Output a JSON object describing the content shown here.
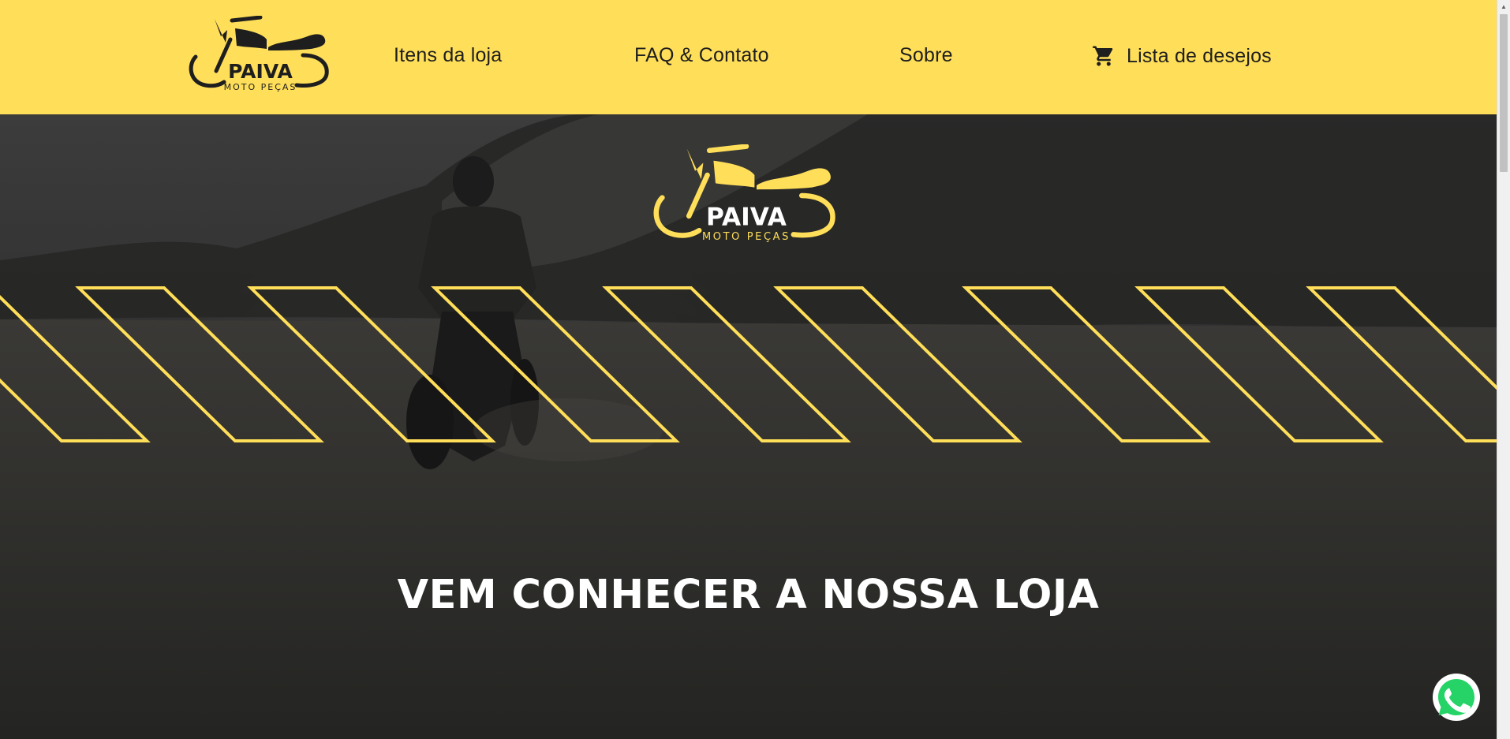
{
  "brand": {
    "name": "PAIVA",
    "subtitle": "MOTO PEÇAS"
  },
  "nav": {
    "items": [
      {
        "label": "Itens da loja"
      },
      {
        "label": "FAQ & Contato"
      },
      {
        "label": "Sobre"
      },
      {
        "label": "Lista de desejos",
        "icon": "cart-icon"
      }
    ]
  },
  "hero": {
    "title": "VEM CONHECER A NOSSA LOJA"
  },
  "colors": {
    "accent_yellow": "#ffde59",
    "text_dark": "#1e1e1e",
    "whatsapp_green": "#25d366"
  }
}
